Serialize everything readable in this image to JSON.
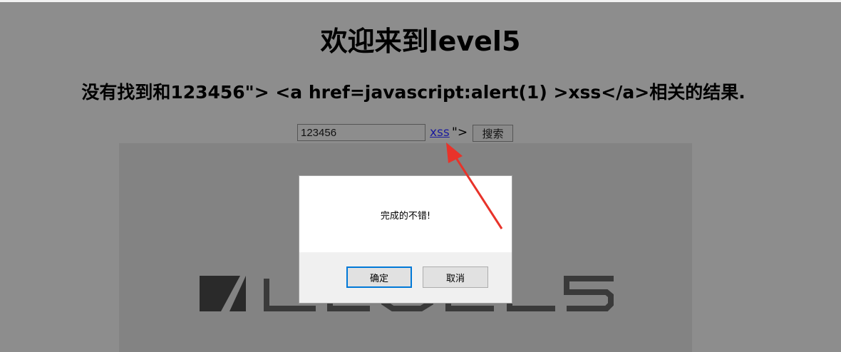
{
  "page": {
    "title": "欢迎来到level5",
    "result_message": "没有找到和123456\"> <a href=javascript:alert(1) >xss</a>相关的结果."
  },
  "search": {
    "value": "123456",
    "injected_link_text": "xss",
    "injected_trailing_text": "\">",
    "button_label": "搜索"
  },
  "banner_image": {
    "logo_text": "LEVEL5"
  },
  "dialog": {
    "message": "完成的不错!",
    "ok_label": "确定",
    "cancel_label": "取消"
  },
  "colors": {
    "page_background": "#8d8d8d",
    "dialog_ok_border": "#0078d7",
    "annotation_arrow": "#e8332a",
    "link": "#1a1a9e"
  }
}
